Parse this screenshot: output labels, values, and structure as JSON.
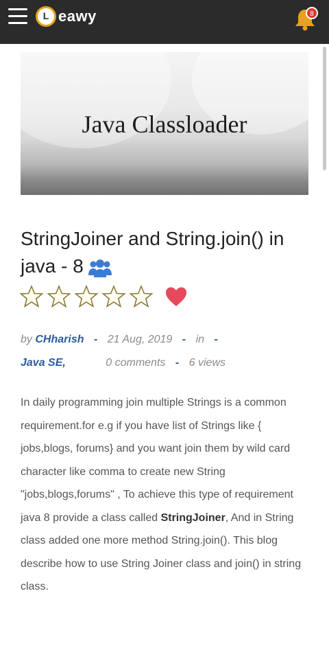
{
  "header": {
    "logo_letter": "L",
    "logo_text": "eawy",
    "notification_count": "8"
  },
  "banner": {
    "title": "Java Classloader"
  },
  "post": {
    "title": "StringJoiner and String.join() in java - 8",
    "rating_stars": 5,
    "by_label": "by",
    "author": "CHharish",
    "separator": "-",
    "date": "21 Aug, 2019",
    "in_label": "in",
    "category": "Java SE,",
    "comments": "0 comments",
    "views": "6 views",
    "body_part1": "In daily programming join multiple Strings is a common requirement.for e.g if you have list of Strings like { jobs,blogs, forums} and you want join them by wild card character like comma to create new String \"jobs,blogs,forums\" , To achieve this type of requirement java 8 provide a class called ",
    "body_bold": "StringJoiner",
    "body_part2": ", And in String class added one more method String.join(). This blog describe how to use String Joiner class and join() in string class."
  },
  "colors": {
    "topbar": "#2b2b2b",
    "accent_orange": "#e8a11c",
    "link_blue": "#2a5a9e",
    "heart_red": "#e6495a",
    "people_icon": "#3a7bd5"
  }
}
